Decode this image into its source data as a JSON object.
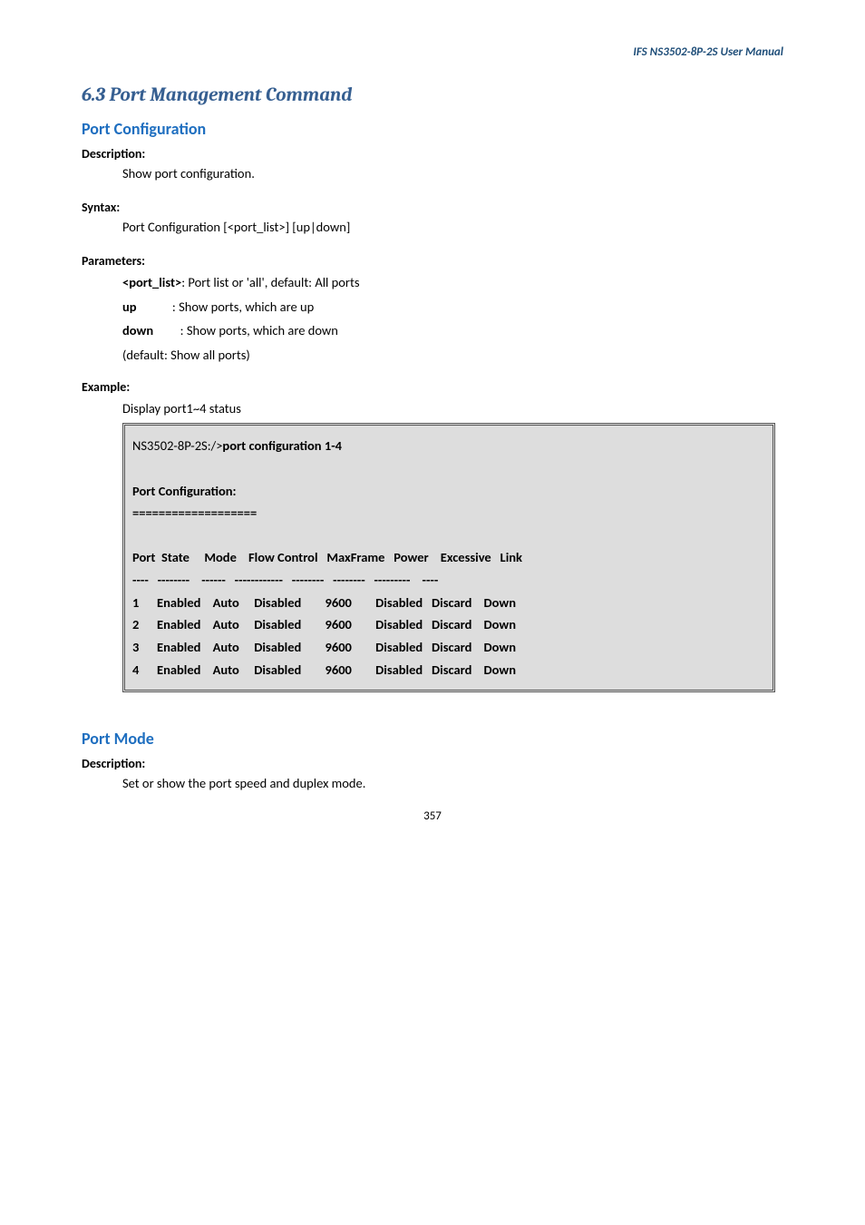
{
  "header": {
    "doc_title": "IFS  NS3502-8P-2S  User  Manual"
  },
  "section": {
    "heading": "6.3 Port Management Command"
  },
  "port_configuration": {
    "title": "Port Configuration",
    "desc_label": "Description:",
    "desc_text": "Show port configuration.",
    "syntax_label": "Syntax:",
    "syntax_text": "Port Configuration [<port_list>] [up|down]",
    "params_label": "Parameters:",
    "params": [
      {
        "key": "<port_list>",
        "sep": ": ",
        "text": "Port list or 'all', default: All ports"
      },
      {
        "key": "up",
        "sep": "            : ",
        "text": "Show ports, which are up"
      },
      {
        "key": "down",
        "sep": "         : ",
        "text": "Show ports, which are down"
      }
    ],
    "params_default": "(default: Show all ports)",
    "example_label": "Example:",
    "example_text": "Display port1~4 status",
    "cli_prompt": "NS3502-8P-2S:/>",
    "cli_cmd": "port configuration 1-4",
    "cli_heading": "Port Configuration:",
    "cli_divider": "===================",
    "cli_columns": "Port  State     Mode    Flow Control   MaxFrame   Power    Excessive   Link",
    "cli_col_underline": "----   --------    ------   ------------   --------   --------   ---------    ----",
    "cli_rows": [
      "1      Enabled    Auto     Disabled        9600        Disabled   Discard    Down",
      "2      Enabled    Auto     Disabled        9600        Disabled   Discard    Down",
      "3      Enabled    Auto     Disabled        9600        Disabled   Discard    Down",
      "4      Enabled    Auto     Disabled        9600        Disabled   Discard    Down"
    ]
  },
  "port_mode": {
    "title": "Port Mode",
    "desc_label": "Description:",
    "desc_text": "Set or show the port speed and duplex mode."
  },
  "footer": {
    "page": "357"
  }
}
